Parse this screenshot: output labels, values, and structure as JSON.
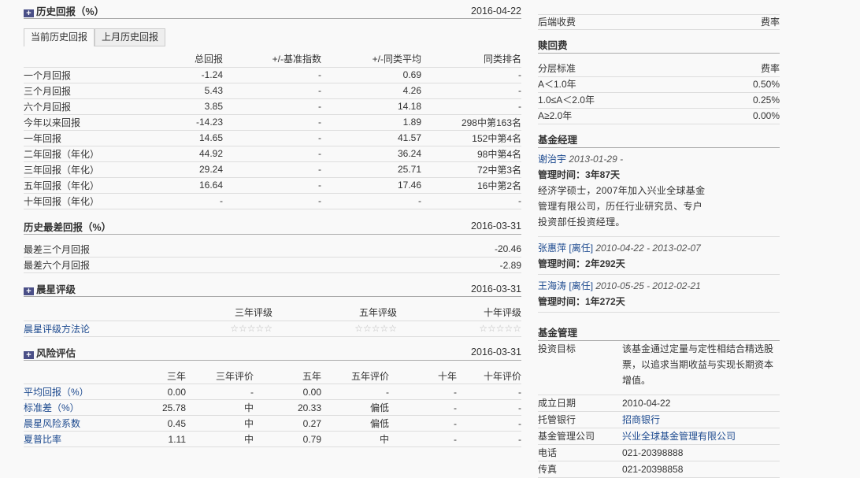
{
  "history": {
    "title": "历史回报（%）",
    "date": "2016-04-22",
    "tabs": [
      "当前历史回报",
      "上月历史回报"
    ],
    "headers": [
      "",
      "总回报",
      "+/-基准指数",
      "+/-同类平均",
      "同类排名"
    ],
    "rows": [
      [
        "一个月回报",
        "-1.24",
        "-",
        "0.69",
        "-"
      ],
      [
        "三个月回报",
        "5.43",
        "-",
        "4.26",
        "-"
      ],
      [
        "六个月回报",
        "3.85",
        "-",
        "14.18",
        "-"
      ],
      [
        "今年以来回报",
        "-14.23",
        "-",
        "1.89",
        "298中第163名"
      ],
      [
        "一年回报",
        "14.65",
        "-",
        "41.57",
        "152中第4名"
      ],
      [
        "二年回报（年化）",
        "44.92",
        "-",
        "36.24",
        "98中第4名"
      ],
      [
        "三年回报（年化）",
        "29.24",
        "-",
        "25.71",
        "72中第3名"
      ],
      [
        "五年回报（年化）",
        "16.64",
        "-",
        "17.46",
        "16中第2名"
      ],
      [
        "十年回报（年化）",
        "-",
        "-",
        "-",
        "-"
      ]
    ]
  },
  "worst": {
    "title": "历史最差回报（%）",
    "date": "2016-03-31",
    "rows": [
      [
        "最差三个月回报",
        "-20.46"
      ],
      [
        "最差六个月回报",
        "-2.89"
      ]
    ]
  },
  "rating": {
    "title": "晨星评级",
    "date": "2016-03-31",
    "headers": [
      "",
      "三年评级",
      "五年评级",
      "十年评级"
    ],
    "method_link": "晨星评级方法论",
    "stars": [
      "☆☆☆☆☆",
      "☆☆☆☆☆",
      "☆☆☆☆☆"
    ]
  },
  "risk": {
    "title": "风险评估",
    "date": "2016-03-31",
    "headers": [
      "",
      "三年",
      "三年评价",
      "五年",
      "五年评价",
      "十年",
      "十年评价"
    ],
    "rows": [
      [
        "平均回报（%）",
        "0.00",
        "-",
        "0.00",
        "-",
        "-",
        "-"
      ],
      [
        "标准差（%）",
        "25.78",
        "中",
        "20.33",
        "偏低",
        "-",
        "-"
      ],
      [
        "晨星风险系数",
        "0.45",
        "中",
        "0.27",
        "偏低",
        "-",
        "-"
      ],
      [
        "夏普比率",
        "1.11",
        "中",
        "0.79",
        "中",
        "-",
        "-"
      ]
    ]
  },
  "backend_fee": {
    "label": "后端收费",
    "rate": "费率"
  },
  "redemption": {
    "title": "赎回费",
    "headers": [
      "分层标准",
      "费率"
    ],
    "rows": [
      [
        "A＜1.0年",
        "0.50%"
      ],
      [
        "1.0≤A＜2.0年",
        "0.25%"
      ],
      [
        "A≥2.0年",
        "0.00%"
      ]
    ]
  },
  "managers": {
    "title": "基金经理",
    "items": [
      {
        "name": "谢治宇",
        "status": "",
        "period": "2013-01-29 -",
        "tenure": "管理时间：3年87天",
        "bio": "经济学硕士，2007年加入兴业全球基金管理有限公司，历任行业研究员、专户投资部任投资经理。"
      },
      {
        "name": "张惠萍",
        "status": "[离任]",
        "period": "2010-04-22 - 2013-02-07",
        "tenure": "管理时间：2年292天",
        "bio": ""
      },
      {
        "name": "王海涛",
        "status": "[离任]",
        "period": "2010-05-25 - 2012-02-21",
        "tenure": "管理时间：1年272天",
        "bio": ""
      }
    ]
  },
  "management": {
    "title": "基金管理",
    "rows": [
      {
        "k": "投资目标",
        "v": "该基金通过定量与定性相结合精选股票，以追求当期收益与实现长期资本增值。",
        "link": false
      },
      {
        "k": "成立日期",
        "v": "2010-04-22",
        "link": false
      },
      {
        "k": "托管银行",
        "v": "招商银行",
        "link": true
      },
      {
        "k": "基金管理公司",
        "v": "兴业全球基金管理有限公司",
        "link": true
      },
      {
        "k": "电话",
        "v": "021-20398888",
        "link": false
      },
      {
        "k": "传真",
        "v": "021-20398858",
        "link": false
      }
    ]
  }
}
